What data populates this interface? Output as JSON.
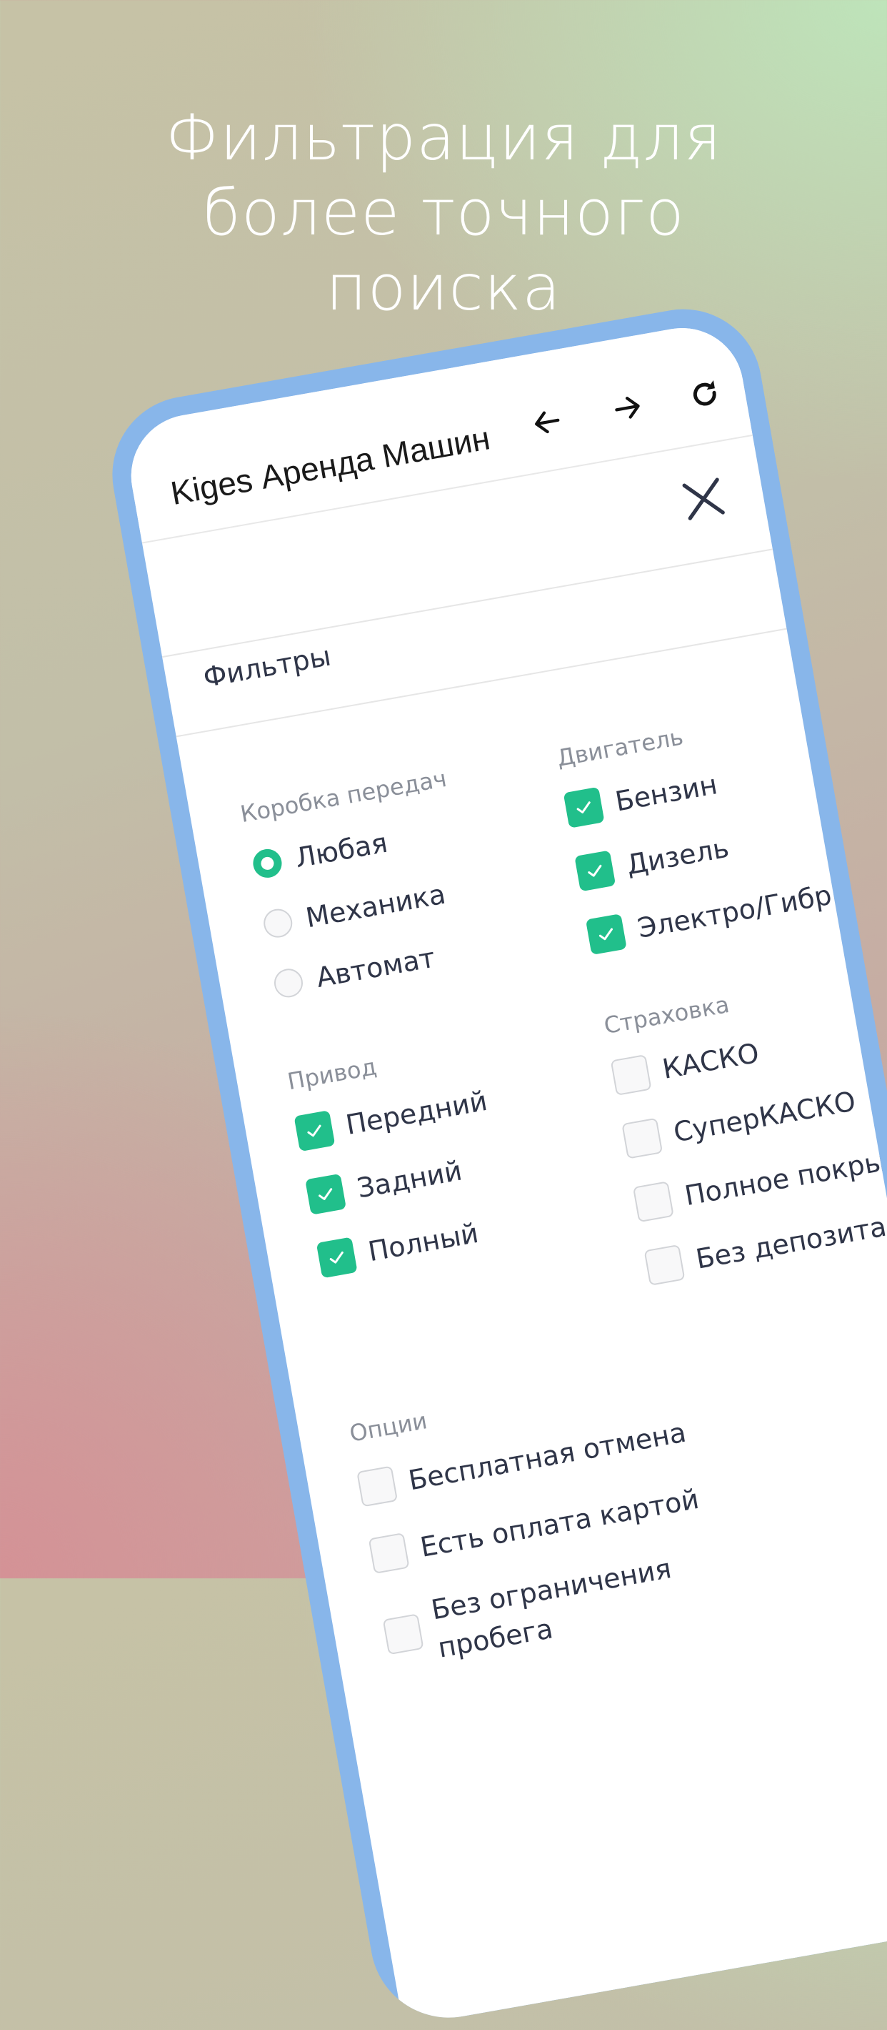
{
  "promo": {
    "title_line1": "Фильтрация для",
    "title_line2": "более точного",
    "title_line3": "поиска"
  },
  "browser": {
    "app_title": "Kiges Аренда Машин",
    "icons": [
      "back-arrow-icon",
      "forward-arrow-icon",
      "reload-icon",
      "more-vert-icon"
    ]
  },
  "modal": {
    "close_icon": "close-icon",
    "title": "Фильтры"
  },
  "filters": {
    "transmission": {
      "label": "Коробка передач",
      "options": [
        {
          "label": "Любая",
          "selected": true
        },
        {
          "label": "Механика",
          "selected": false
        },
        {
          "label": "Автомат",
          "selected": false
        }
      ]
    },
    "engine": {
      "label": "Двигатель",
      "options": [
        {
          "label": "Бензин",
          "checked": true
        },
        {
          "label": "Дизель",
          "checked": true
        },
        {
          "label": "Электро/Гибрид",
          "checked": true
        }
      ]
    },
    "drive": {
      "label": "Привод",
      "options": [
        {
          "label": "Передний",
          "checked": true
        },
        {
          "label": "Задний",
          "checked": true
        },
        {
          "label": "Полный",
          "checked": true
        }
      ]
    },
    "insurance": {
      "label": "Страховка",
      "options": [
        {
          "label": "КАСКО",
          "checked": false
        },
        {
          "label": "СуперКАСКО",
          "checked": false
        },
        {
          "label": "Полное покрытие",
          "checked": false
        },
        {
          "label": "Без депозита",
          "checked": false
        }
      ]
    },
    "extras": {
      "label": "Опции",
      "options": [
        {
          "label": "Бесплатная отмена",
          "checked": false
        },
        {
          "label": "Есть оплата картой",
          "checked": false
        },
        {
          "label_line1": "Без ограничения",
          "label_line2": "пробега",
          "checked": false
        }
      ]
    }
  },
  "colors": {
    "accent": "#21bf8b",
    "phone_frame": "#88b6ea",
    "text": "#2f3548",
    "muted": "#8a8f99"
  }
}
